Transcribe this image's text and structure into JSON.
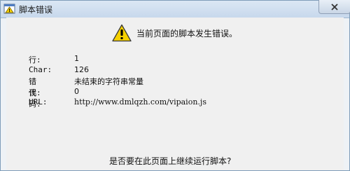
{
  "window": {
    "title": "脚本错误",
    "close_icon": "close-icon",
    "app_icon": "script-error-icon",
    "title_gradient": [
      "#dbe7f4",
      "#c7d8ec"
    ]
  },
  "dialog": {
    "warning_icon": "warning-icon",
    "warning_color": "#f5d000",
    "headline": "当前页面的脚本发生错误。",
    "details": [
      {
        "key": "行:",
        "value": "1"
      },
      {
        "key": "Char:",
        "value": "126"
      },
      {
        "key": "错误:",
        "value": "未结束的字符串常量"
      },
      {
        "key": "代码:",
        "value": "0"
      },
      {
        "key": "URL:",
        "value": "http://www.dmlqzh.com/vipaion.js"
      }
    ],
    "question": "是否要在此页面上继续运行脚本?"
  }
}
